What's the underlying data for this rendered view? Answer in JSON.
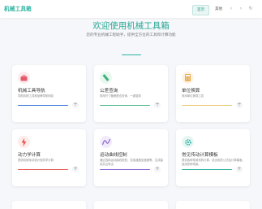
{
  "header": {
    "logo": "机械工具箱",
    "nav": [
      {
        "label": "首页"
      },
      {
        "label": "其他"
      }
    ],
    "controls": [
      "‹",
      "›",
      "↻"
    ]
  },
  "hero": {
    "title": "欢迎使用机械工具箱",
    "subtitle": "您的专业机械工程助手，提供全方位的工具和计算功能"
  },
  "cards": [
    {
      "title": "机械工具导航",
      "desc": "导航机械工具和品牌导航网站",
      "icon": "toolbox-icon",
      "color": "#e35a6a",
      "bg": "#fdecee"
    },
    {
      "title": "公差查询",
      "desc": "常用尺寸偏差配合查询，一键复制",
      "icon": "ruler-icon",
      "color": "#3fb27f",
      "bg": "#e9f7ef"
    },
    {
      "title": "单位换算",
      "desc": "常用单位换算工具",
      "icon": "calculator-icon",
      "color": "#e9a94a",
      "bg": "#fdf3e4"
    },
    {
      "title": "动力学计算",
      "desc": "提供机械传动设计相关学计算",
      "icon": "bolt-icon",
      "color": "#e85a4f",
      "bg": "#fdecea"
    },
    {
      "title": "运动曲线控制",
      "desc": "通过选择运动曲线类型，包括速度加速度等，生成曲线并且导出",
      "icon": "curve-icon",
      "color": "#8a63d2",
      "bg": "#f1ebfb"
    },
    {
      "title": "常见传动计算模板",
      "desc": "提供各种常用机构计算，给出相关公式及计算模板，适用多种场景。",
      "icon": "gear-icon",
      "color": "#2bb3a0",
      "bg": "#e6f6f3"
    }
  ]
}
